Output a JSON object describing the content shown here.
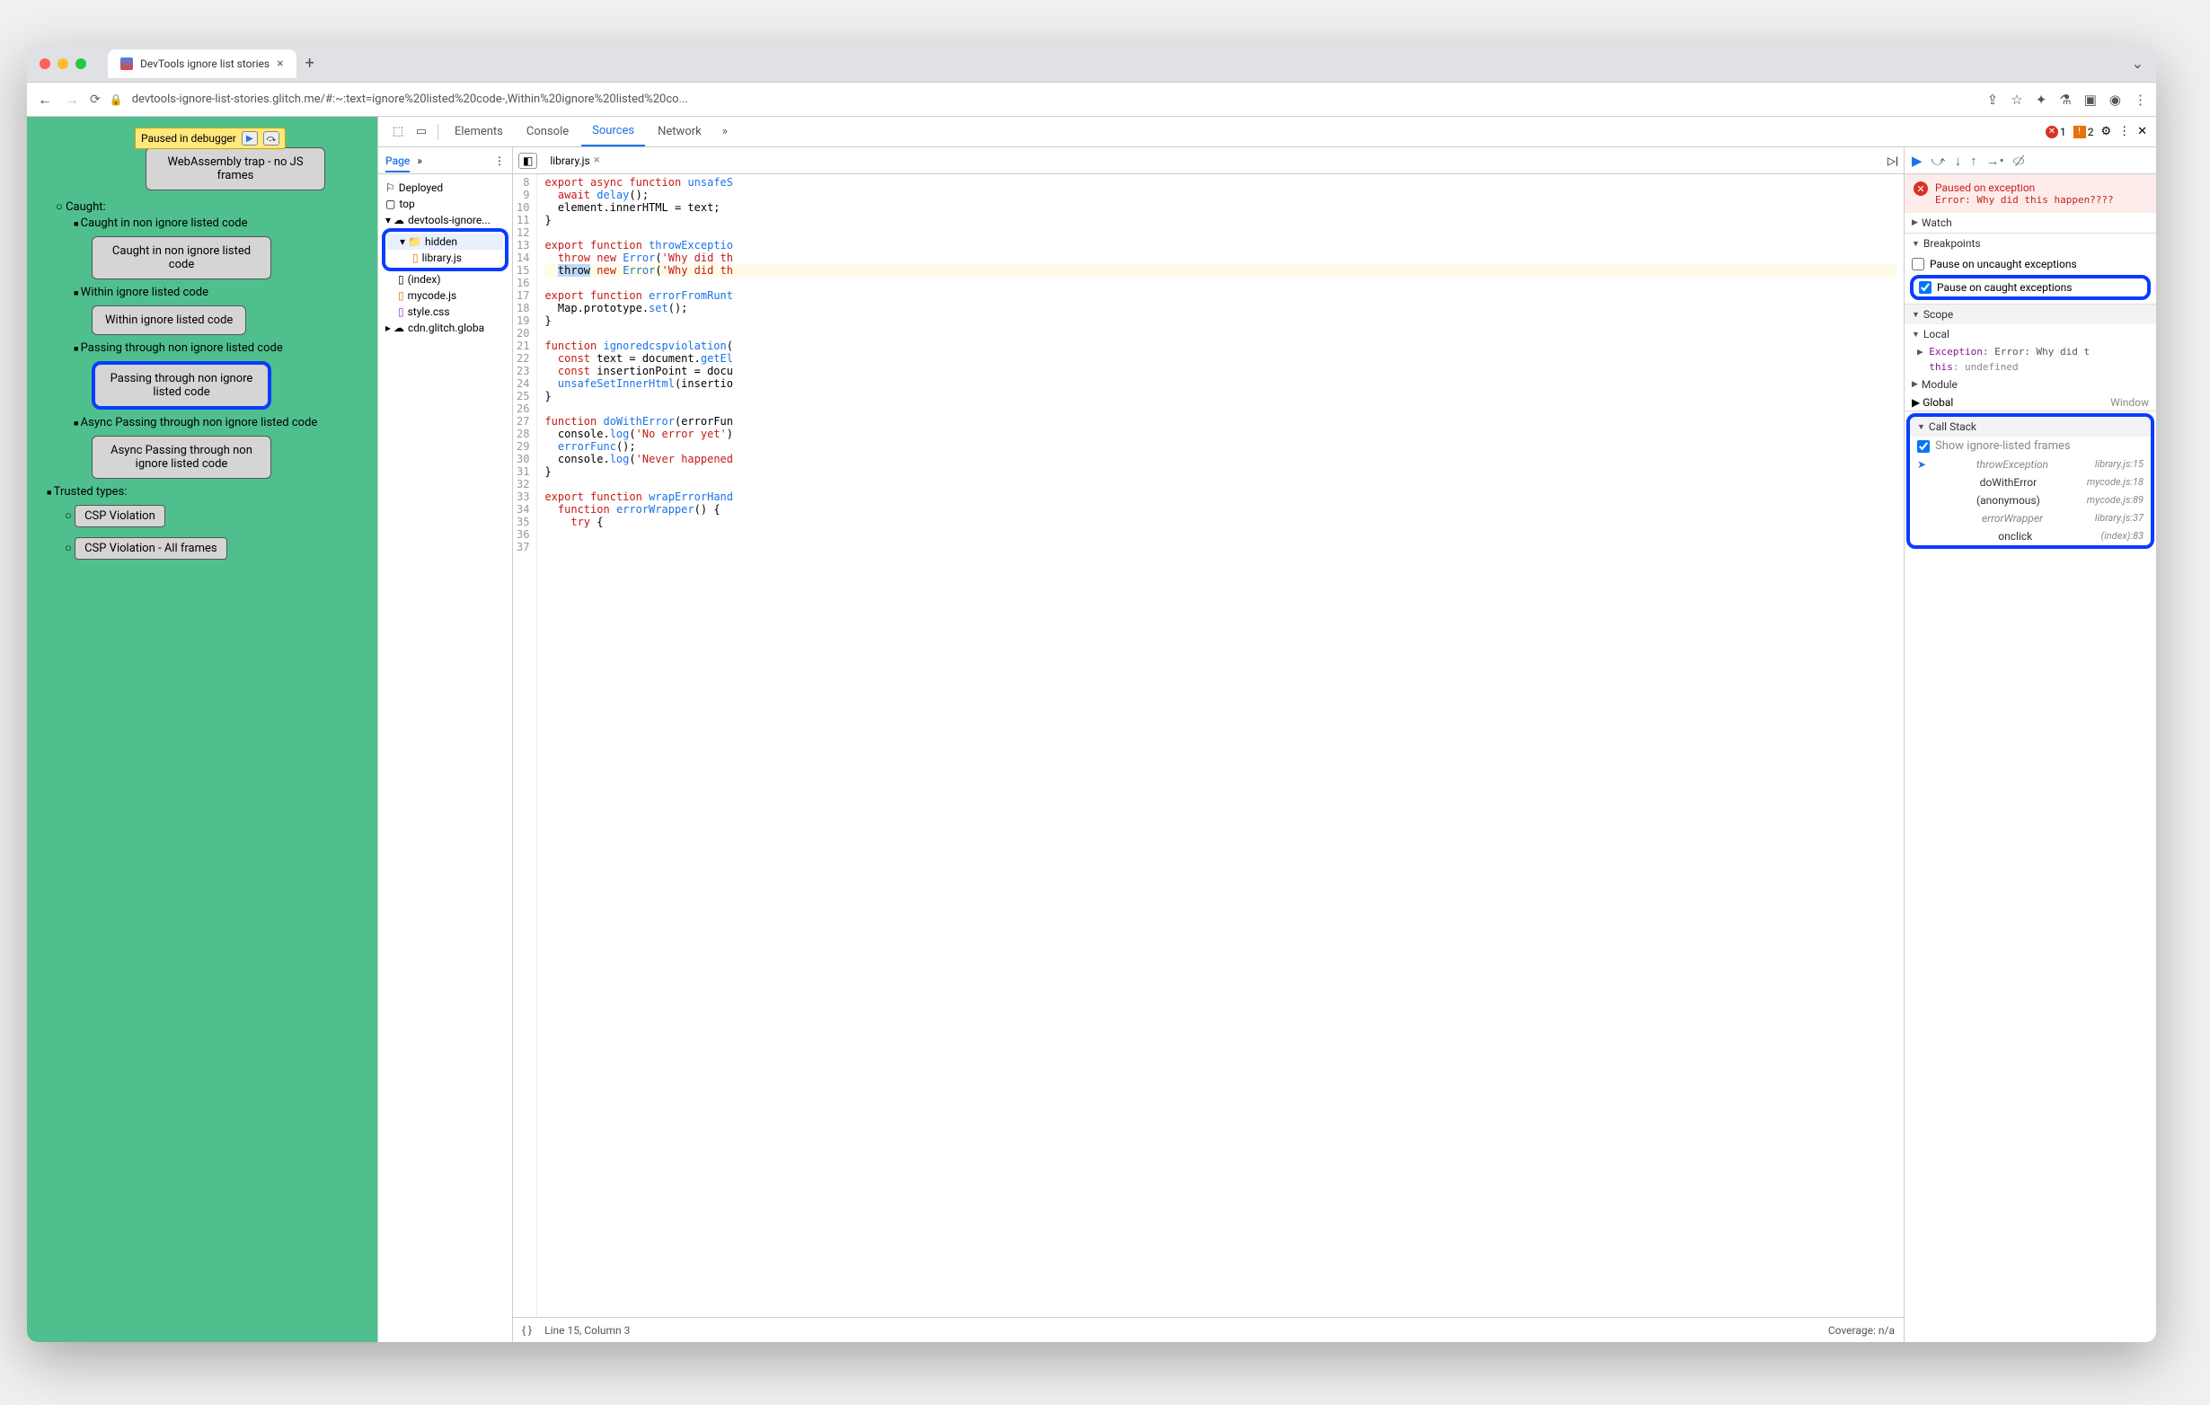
{
  "browser": {
    "tab_title": "DevTools ignore list stories",
    "url": "devtools-ignore-list-stories.glitch.me/#:~:text=ignore%20listed%20code-,Within%20ignore%20listed%20co..."
  },
  "paused_overlay": "Paused in debugger",
  "page_items": {
    "wa_trap": "WebAssembly trap - no JS frames",
    "caught_h": "Caught:",
    "caught_non": "Caught in non ignore listed code",
    "caught_non_btn": "Caught in non ignore listed code",
    "within": "Within ignore listed code",
    "within_btn": "Within ignore listed code",
    "pass": "Passing through non ignore listed code",
    "pass_btn": "Passing through non ignore listed code",
    "async_pass": "Async Passing through non ignore listed code",
    "async_pass_btn": "Async Passing through non ignore listed code",
    "trusted": "Trusted types:",
    "csp1": "CSP Violation",
    "csp2": "CSP Violation - All frames"
  },
  "devtools": {
    "tabs": {
      "elements": "Elements",
      "console": "Console",
      "sources": "Sources",
      "network": "Network"
    },
    "errors": "1",
    "issues": "2",
    "nav_tab": "Page",
    "tree": {
      "deployed": "Deployed",
      "top": "top",
      "domain": "devtools-ignore...",
      "hidden": "hidden",
      "library": "library.js",
      "index": "(index)",
      "mycode": "mycode.js",
      "style": "style.css",
      "cdn": "cdn.glitch.globa"
    },
    "open_file": "library.js",
    "gutter_start": 8,
    "gutter_end": 37,
    "code_lines": [
      "export async function unsafeS",
      "  await delay();",
      "  element.innerHTML = text;",
      "}",
      "",
      "export function throwExceptio",
      "  throw new Error('Why did th",
      "}",
      "",
      "export function errorFromRunt",
      "  Map.prototype.set();",
      "}",
      "",
      "function ignoredcspviolation(",
      "  const text = document.getEl",
      "  const insertionPoint = docu",
      "  unsafeSetInnerHtml(insertio",
      "}",
      "",
      "function doWithError(errorFun",
      "  console.log('No error yet')",
      "  errorFunc();",
      "  console.log('Never happened",
      "}",
      "",
      "export function wrapErrorHand",
      "  function errorWrapper() {",
      "    try {",
      ""
    ],
    "status": {
      "pos": "Line 15, Column 3",
      "coverage": "Coverage: n/a"
    },
    "paused": {
      "title": "Paused on exception",
      "msg": "Error: Why did this happen????"
    },
    "watch": "Watch",
    "breakpoints": "Breakpoints",
    "bp1": "Pause on uncaught exceptions",
    "bp2": "Pause on caught exceptions",
    "scope": "Scope",
    "local": "Local",
    "exc_label": "Exception",
    "exc_val": ": Error: Why did t",
    "this_label": "this",
    "this_val": ": undefined",
    "module": "Module",
    "global": "Global",
    "global_val": "Window",
    "callstack": "Call Stack",
    "show_ignored": "Show ignore-listed frames",
    "frames": [
      {
        "fn": "throwException",
        "loc": "library.js:15",
        "ign": true,
        "cur": true
      },
      {
        "fn": "doWithError",
        "loc": "mycode.js:18",
        "ign": false
      },
      {
        "fn": "(anonymous)",
        "loc": "mycode.js:89",
        "ign": false
      },
      {
        "fn": "errorWrapper",
        "loc": "library.js:37",
        "ign": true
      },
      {
        "fn": "onclick",
        "loc": "(index):83",
        "ign": false
      }
    ]
  }
}
